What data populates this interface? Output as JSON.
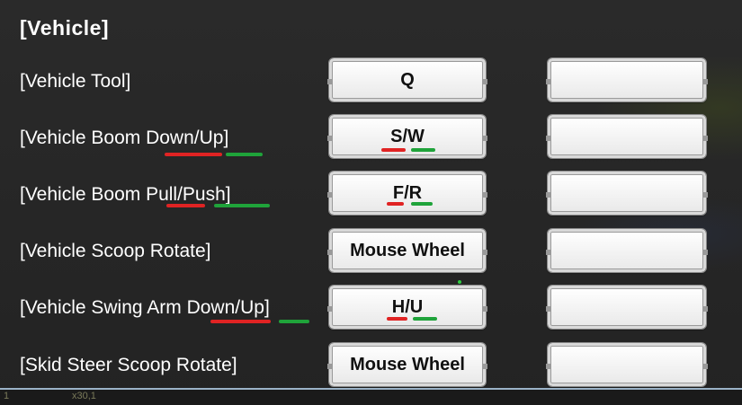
{
  "section": {
    "title": "[Vehicle]"
  },
  "rows": [
    {
      "label": "[Vehicle Tool]",
      "key1": "Q",
      "key2": ""
    },
    {
      "label": "[Vehicle Boom Down/Up]",
      "key1": "S/W",
      "key2": ""
    },
    {
      "label": "[Vehicle Boom Pull/Push]",
      "key1": "F/R",
      "key2": ""
    },
    {
      "label": "[Vehicle Scoop Rotate]",
      "key1": "Mouse Wheel",
      "key2": ""
    },
    {
      "label": "[Vehicle Swing Arm Down/Up]",
      "key1": "H/U",
      "key2": ""
    },
    {
      "label": "[Skid Steer Scoop Rotate]",
      "key1": "Mouse Wheel",
      "key2": ""
    }
  ],
  "hud": {
    "left": "1",
    "count": "x30,1"
  },
  "colors": {
    "underline_red": "#e02323",
    "underline_green": "#1fa33a",
    "background": "#262626"
  }
}
